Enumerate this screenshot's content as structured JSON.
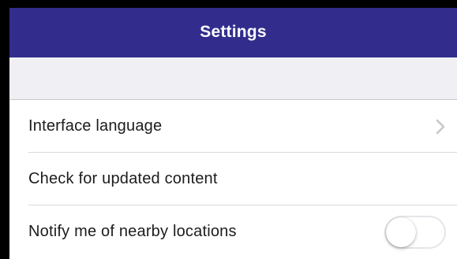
{
  "header": {
    "title": "Settings"
  },
  "settings": {
    "items": [
      {
        "label": "Interface language",
        "accessory": "chevron-right-icon"
      },
      {
        "label": "Check for updated content",
        "accessory": "none"
      },
      {
        "label": "Notify me of nearby locations",
        "accessory": "toggle",
        "toggle_on": false
      }
    ]
  },
  "colors": {
    "nav_bar": "#322d8c",
    "nav_text": "#ffffff",
    "section_background": "#efeff4",
    "separator": "#d9d9dd",
    "chevron": "#c7c7cc"
  }
}
